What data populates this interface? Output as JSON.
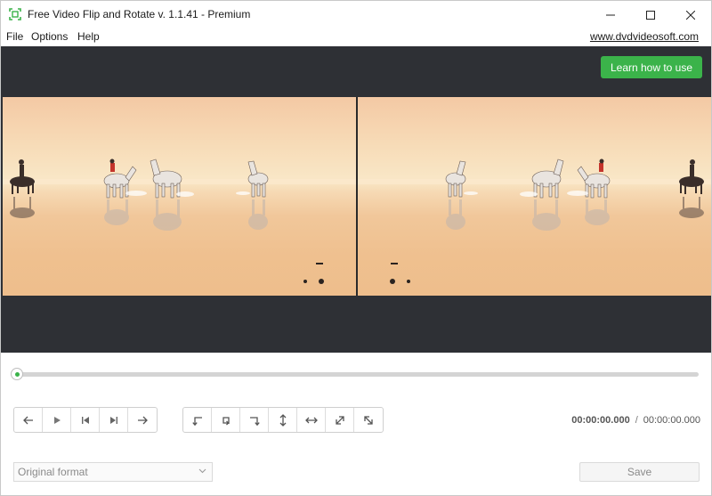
{
  "window": {
    "title": "Free Video Flip and Rotate v. 1.1.41 - Premium"
  },
  "menu": {
    "items": [
      {
        "label": "File"
      },
      {
        "label": "Options"
      },
      {
        "label": "Help"
      }
    ],
    "site_link": "www.dvdvideosoft.com"
  },
  "preview": {
    "learn_button": "Learn how to use"
  },
  "timeline": {
    "position_fraction": 0.0
  },
  "playback": {
    "buttons": [
      "arrow-left-icon",
      "play-icon",
      "skip-start-icon",
      "skip-end-icon",
      "arrow-right-icon"
    ]
  },
  "transform": {
    "buttons": [
      "rotate-left-icon",
      "rotate-right-icon",
      "rotate-180-icon",
      "flip-vertical-icon",
      "flip-horizontal-icon",
      "diagonal-expand-icon",
      "diagonal-shrink-icon"
    ]
  },
  "time": {
    "current": "00:00:00.000",
    "separator": "/",
    "total": "00:00:00.000"
  },
  "output": {
    "format_selected": "Original format",
    "save_label": "Save"
  },
  "colors": {
    "accent": "#3bb34a",
    "preview_background": "#2e3035"
  }
}
